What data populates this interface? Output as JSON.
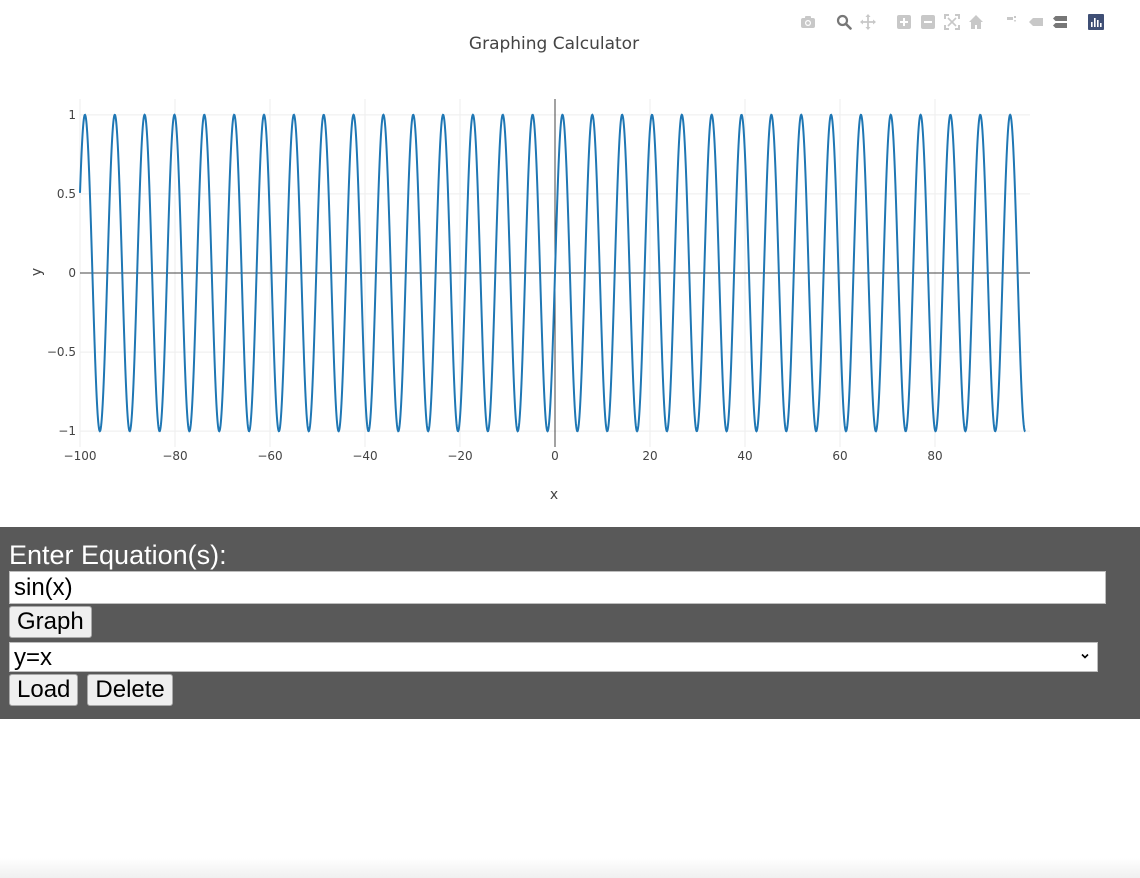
{
  "plot": {
    "toolbar": [
      {
        "name": "camera-icon"
      },
      {
        "name": "zoom-icon"
      },
      {
        "name": "pan-icon"
      },
      {
        "name": "zoom-in-icon"
      },
      {
        "name": "zoom-out-icon"
      },
      {
        "name": "autoscale-icon"
      },
      {
        "name": "home-icon"
      },
      {
        "name": "spike-lines-icon"
      },
      {
        "name": "hover-closest-icon"
      },
      {
        "name": "hover-compare-icon"
      },
      {
        "name": "plotly-logo-icon"
      }
    ],
    "colors": {
      "line": "#1f77b4",
      "grid": "#eeeeee",
      "zeroline": "#444444",
      "text": "#444444"
    }
  },
  "chart_data": {
    "type": "line",
    "title": "Graphing Calculator",
    "xlabel": "x",
    "ylabel": "y",
    "function": "sin(x)",
    "x_domain": [
      -100,
      99
    ],
    "xlim": [
      -100,
      100
    ],
    "ylim": [
      -1.1,
      1.1
    ],
    "x_ticks": [
      -100,
      -80,
      -60,
      -40,
      -20,
      0,
      20,
      40,
      60,
      80
    ],
    "x_tick_labels": [
      "−100",
      "−80",
      "−60",
      "−40",
      "−20",
      "0",
      "20",
      "40",
      "60",
      "80"
    ],
    "y_ticks": [
      1,
      0.5,
      0,
      -0.5,
      -1
    ],
    "y_tick_labels": [
      "1",
      "0.5",
      "0",
      "−0.5",
      "−1"
    ],
    "grid": true,
    "series": [
      {
        "color": "#1f77b4"
      }
    ]
  },
  "panel": {
    "label": "Enter Equation(s):",
    "equation_value": "sin(x)",
    "graph_button": "Graph",
    "saved_select_value": "y=x",
    "load_button": "Load",
    "delete_button": "Delete",
    "background": "#595959"
  }
}
